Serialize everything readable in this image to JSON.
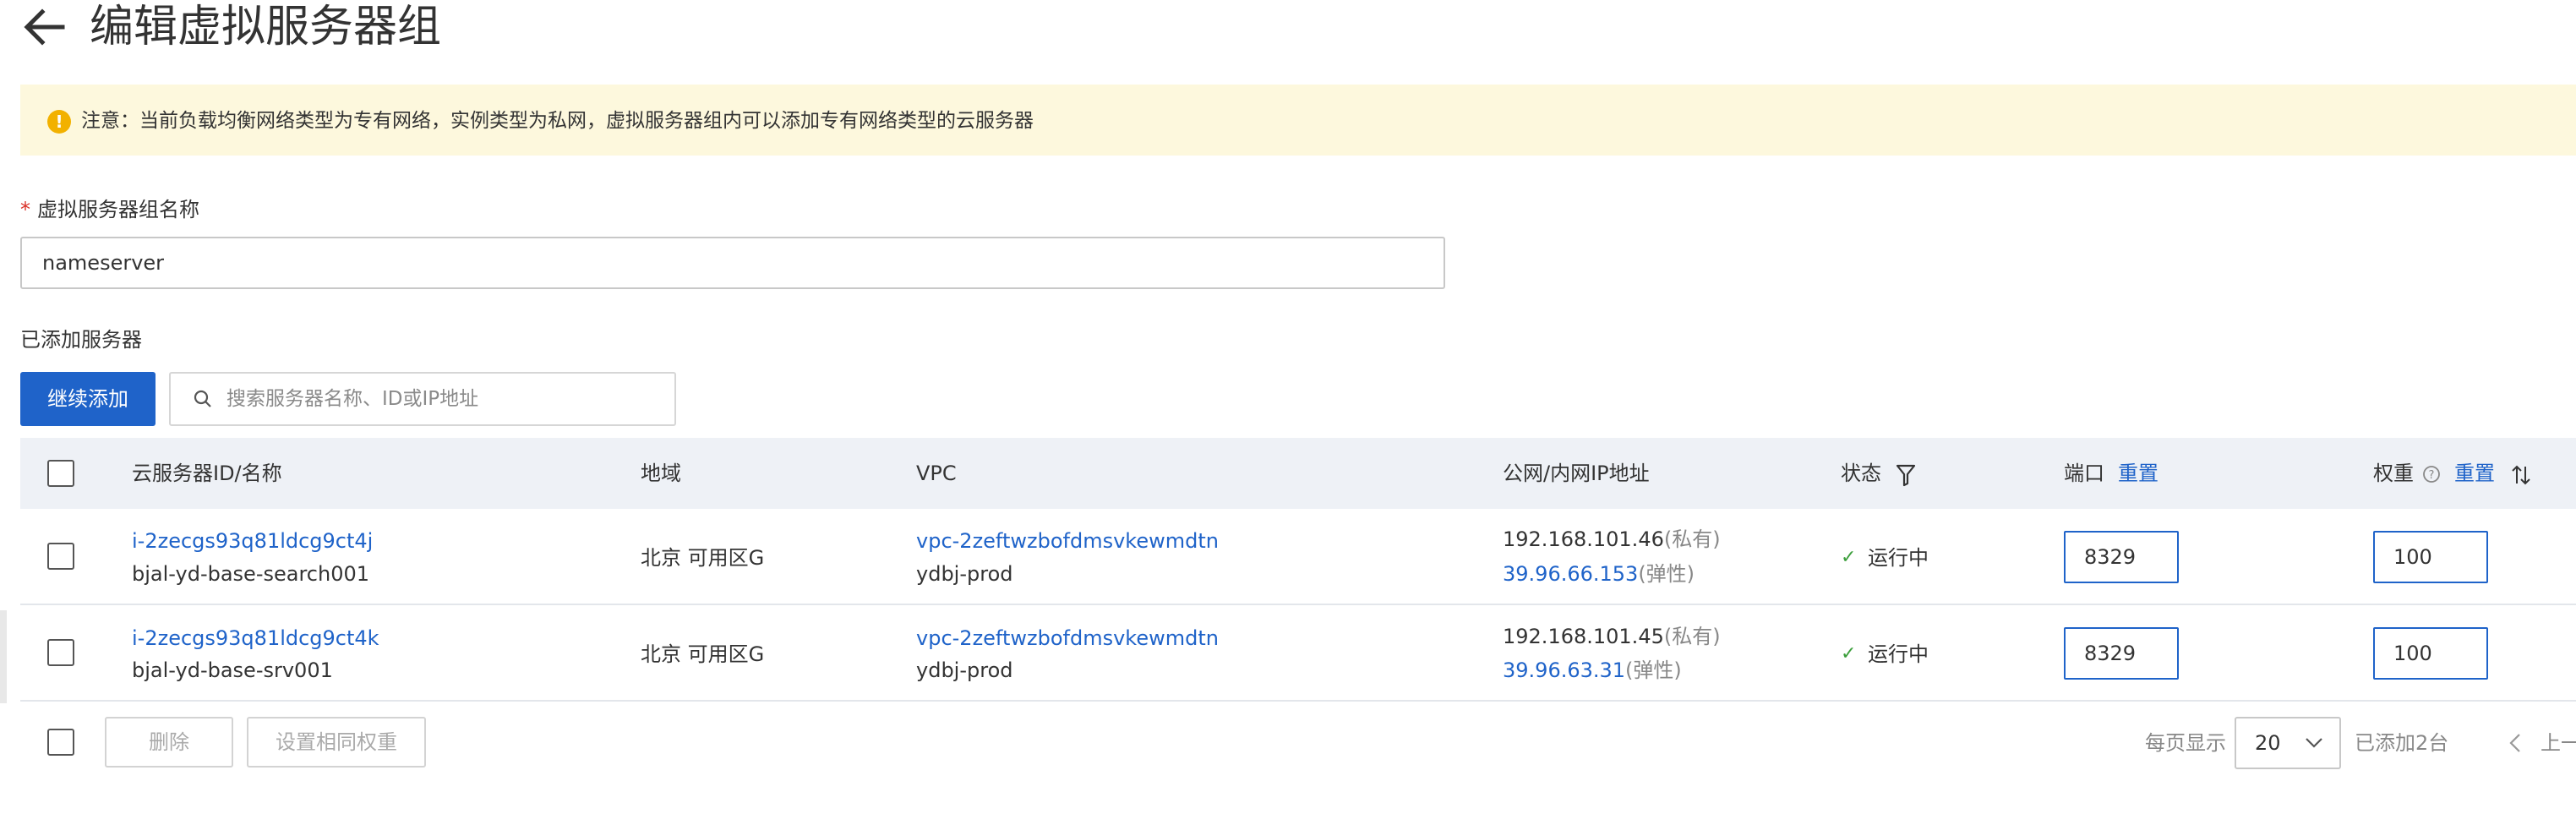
{
  "header": {
    "title": "编辑虚拟服务器组",
    "back_icon": "arrow-left-icon"
  },
  "notice": {
    "icon": "warning-icon",
    "icon_color": "#f2b100",
    "background": "#fdf8dd",
    "text": "注意：当前负载均衡网络类型为专有网络，实例类型为私网，虚拟服务器组内可以添加专有网络类型的云服务器"
  },
  "form": {
    "required_mark": "*",
    "name_label": "虚拟服务器组名称",
    "name_value": "nameserver"
  },
  "servers_section": {
    "label": "已添加服务器",
    "continue_button": "继续添加",
    "search_placeholder": "搜索服务器名称、ID或IP地址"
  },
  "table": {
    "columns": {
      "server": "云服务器ID/名称",
      "region": "地域",
      "vpc": "VPC",
      "ip": "公网/内网IP地址",
      "status": "状态",
      "port": "端口",
      "port_reset": "重置",
      "weight": "权重",
      "weight_reset": "重置"
    },
    "rows": [
      {
        "id": "i-2zecgs93q81ldcg9ct4j",
        "name": "bjal-yd-base-search001",
        "region": "北京 可用区G",
        "vpc_id": "vpc-2zeftwzbofdmsvkewmdtn",
        "vpc_name": "ydbj-prod",
        "private_ip": "192.168.101.46",
        "private_tag": "(私有)",
        "public_ip": "39.96.66.153",
        "public_tag": "(弹性)",
        "status": "运行中",
        "port": "8329",
        "weight": "100"
      },
      {
        "id": "i-2zecgs93q81ldcg9ct4k",
        "name": "bjal-yd-base-srv001",
        "region": "北京 可用区G",
        "vpc_id": "vpc-2zeftwzbofdmsvkewmdtn",
        "vpc_name": "ydbj-prod",
        "private_ip": "192.168.101.45",
        "private_tag": "(私有)",
        "public_ip": "39.96.63.31",
        "public_tag": "(弹性)",
        "status": "运行中",
        "port": "8329",
        "weight": "100"
      }
    ]
  },
  "footer": {
    "delete_button": "删除",
    "same_weight_button": "设置相同权重",
    "per_page_label": "每页显示",
    "page_size": "20",
    "added_count": "已添加2台",
    "prev_label": "上一"
  },
  "colors": {
    "accent": "#1f63c9",
    "status_ok": "#3c9f3c",
    "header_bg": "#eef1f6"
  }
}
